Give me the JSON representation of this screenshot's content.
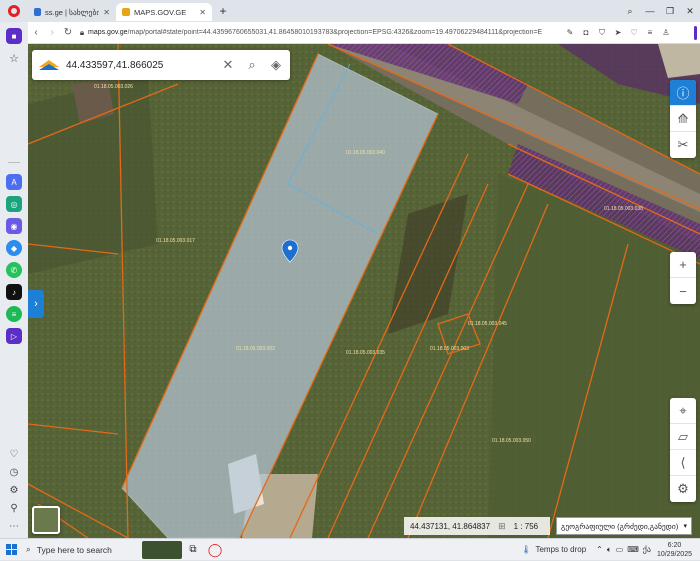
{
  "tabs": [
    {
      "title": "ss.ge | სახლები და ბაქნე",
      "favicon_color": "#2f6fd0",
      "active": false
    },
    {
      "title": "MAPS.GOV.GE",
      "favicon_color": "#e8a317",
      "active": true
    }
  ],
  "address": {
    "domain": "maps.gov.ge",
    "path": "/map/portal#state/point=44.43596760655031,41.86458010193783&projection=EPSG:4326&zoom=19.49706229484111&projection=E"
  },
  "search": {
    "value": "44.433597,41.866025",
    "placeholder": ""
  },
  "status": {
    "coordinates": "44.437131, 41.864837",
    "scale": "1 : 756",
    "layer_selected": "გეოგრაფიული (გრძედი,განედი)"
  },
  "parcel_labels": [
    {
      "text": "01.18.05.003.026"
    },
    {
      "text": "01.18.05.003.040"
    },
    {
      "text": "01.18.05.003.017"
    },
    {
      "text": "01.18.05.003.038"
    },
    {
      "text": "01.18.05.003.002"
    },
    {
      "text": "01.18.05.003.035"
    },
    {
      "text": "01.18.05.003.003"
    },
    {
      "text": "01.18.05.003.050"
    },
    {
      "text": "01.18.05.003.045"
    }
  ],
  "taskbar": {
    "search_placeholder": "Type here to search",
    "weather": "Temps to drop",
    "language": "ქა",
    "time": "6:20",
    "date": "10/29/2025"
  },
  "colors": {
    "parcel_border": "#e36a16",
    "highlight_fill": "#b9c9da",
    "road_fill": "#5a2e68",
    "accent_blue": "#1d7fd6",
    "opera_red": "#e21f26"
  }
}
